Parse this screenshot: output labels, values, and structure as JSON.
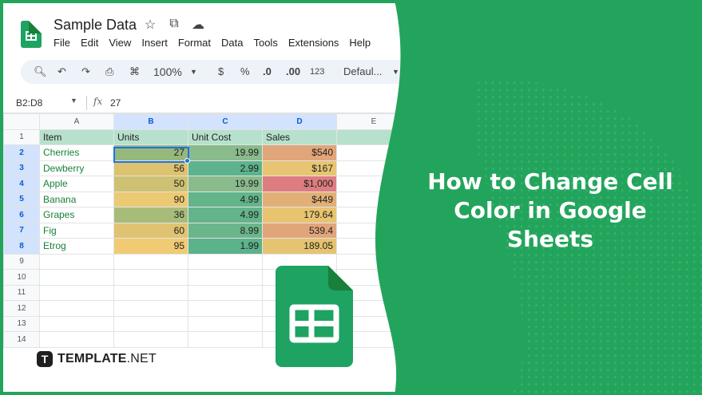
{
  "app": {
    "doc_title": "Sample Data",
    "menu": [
      "File",
      "Edit",
      "View",
      "Insert",
      "Format",
      "Data",
      "Tools",
      "Extensions",
      "Help"
    ],
    "toolbar": {
      "zoom": "100%",
      "currency": "$",
      "percent": "%",
      "dec_decrease": ".0",
      "dec_increase": ".00",
      "number_format": "123",
      "font": "Defaul..."
    },
    "formula_bar": {
      "range": "B2:D8",
      "fx": "fx",
      "value": "27"
    }
  },
  "sheet": {
    "columns": [
      "A",
      "B",
      "C",
      "D",
      "E"
    ],
    "selected_columns": [
      "B",
      "C",
      "D"
    ],
    "header_row": [
      "Item",
      "Units",
      "Unit Cost",
      "Sales"
    ],
    "rows": [
      {
        "n": "2",
        "item": "Cherries",
        "units": "27",
        "cost": "19.99",
        "sales": "$540",
        "colors": [
          "#97b87b",
          "#89bb8c",
          "#e1a57a"
        ]
      },
      {
        "n": "3",
        "item": "Dewberry",
        "units": "56",
        "cost": "2.99",
        "sales": "$167",
        "colors": [
          "#ddc26f",
          "#5db38b",
          "#e8c572"
        ]
      },
      {
        "n": "4",
        "item": "Apple",
        "units": "50",
        "cost": "19.99",
        "sales": "$1,000",
        "colors": [
          "#cfc172",
          "#89bb8c",
          "#de7d80"
        ]
      },
      {
        "n": "5",
        "item": "Banana",
        "units": "90",
        "cost": "4.99",
        "sales": "$449",
        "colors": [
          "#ecca73",
          "#63b48b",
          "#e2b077"
        ]
      },
      {
        "n": "6",
        "item": "Grapes",
        "units": "36",
        "cost": "4.99",
        "sales": "179.64",
        "colors": [
          "#a8bc79",
          "#63b48b",
          "#e8c470"
        ]
      },
      {
        "n": "7",
        "item": "Fig",
        "units": "60",
        "cost": "8.99",
        "sales": "539.4",
        "colors": [
          "#e0c372",
          "#6ab68a",
          "#e1a57a"
        ]
      },
      {
        "n": "8",
        "item": "Etrog",
        "units": "95",
        "cost": "1.99",
        "sales": "189.05",
        "colors": [
          "#f0cb74",
          "#5cb28b",
          "#e6c371"
        ]
      }
    ],
    "empty_rows": [
      "9",
      "10",
      "11",
      "12",
      "13",
      "14"
    ]
  },
  "headline": "How to Change Cell Color in Google Sheets",
  "brand": {
    "bold": "TEMPLATE",
    "light": ".NET",
    "mark": "T"
  },
  "colors": {
    "brand_green": "#23a45c",
    "sheets_green": "#1ea362",
    "selection_blue": "#1a73e8"
  }
}
